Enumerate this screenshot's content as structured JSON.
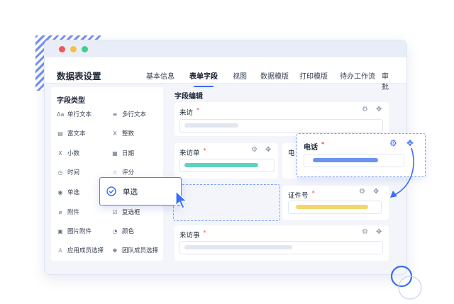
{
  "window": {
    "title": "数据表设置",
    "tabs": [
      {
        "label": "基本信息",
        "active": false
      },
      {
        "label": "表单字段",
        "active": true
      },
      {
        "label": "视图",
        "active": false
      },
      {
        "label": "数据模版",
        "active": false
      },
      {
        "label": "打印模版",
        "active": false
      },
      {
        "label": "待办工作流",
        "active": false
      },
      {
        "label": "审批",
        "active": false
      }
    ]
  },
  "sidebar": {
    "title": "字段类型",
    "items": [
      {
        "icon": "text-aa-icon",
        "glyph": "Aa",
        "label": "单行文本"
      },
      {
        "icon": "multiline-text-icon",
        "glyph": "≡",
        "label": "多行文本"
      },
      {
        "icon": "rich-text-icon",
        "glyph": "▤",
        "label": "富文本"
      },
      {
        "icon": "integer-icon",
        "glyph": "X",
        "label": "整数"
      },
      {
        "icon": "decimal-icon",
        "glyph": "X",
        "label": "小数"
      },
      {
        "icon": "calendar-icon",
        "glyph": "▦",
        "label": "日期"
      },
      {
        "icon": "clock-icon",
        "glyph": "◷",
        "label": "时间"
      },
      {
        "icon": "star-icon",
        "glyph": "☆",
        "label": "评分"
      },
      {
        "icon": "radio-icon",
        "glyph": "◉",
        "label": "单选"
      },
      {
        "icon": "checkbox-icon",
        "glyph": "☑",
        "label": "复选框"
      },
      {
        "icon": "paperclip-icon",
        "glyph": "⌀",
        "label": "附件"
      },
      {
        "icon": "palette-icon",
        "glyph": "◔",
        "label": "颜色"
      },
      {
        "icon": "image-icon",
        "glyph": "▣",
        "label": "图片附件"
      },
      {
        "icon": "user-icon",
        "glyph": "♙",
        "label": "应用成员选择"
      },
      {
        "icon": "team-icon",
        "glyph": "♚",
        "label": "团队成员选择"
      }
    ]
  },
  "drag_chip": {
    "icon": "check-circle-icon",
    "label": "单选"
  },
  "editor": {
    "title": "字段编辑",
    "fields": {
      "visitor": {
        "label": "来访",
        "required": "*"
      },
      "visit_unit": {
        "label": "来访单",
        "required": "*"
      },
      "phone_partial": {
        "label": "电"
      },
      "id_number": {
        "label": "证件号",
        "required": "*"
      },
      "visit_matter": {
        "label": "来访事",
        "required": "*"
      },
      "phone_dragging": {
        "label": "电话",
        "required": "*"
      }
    }
  },
  "colors": {
    "accent": "#3b6cf6",
    "teal_bar": "#5ed3c0",
    "blue_bar": "#6b93ee",
    "yellow_bar": "#f6d56b",
    "grey_bar": "#e2e6ee",
    "required": "#ef4444"
  }
}
